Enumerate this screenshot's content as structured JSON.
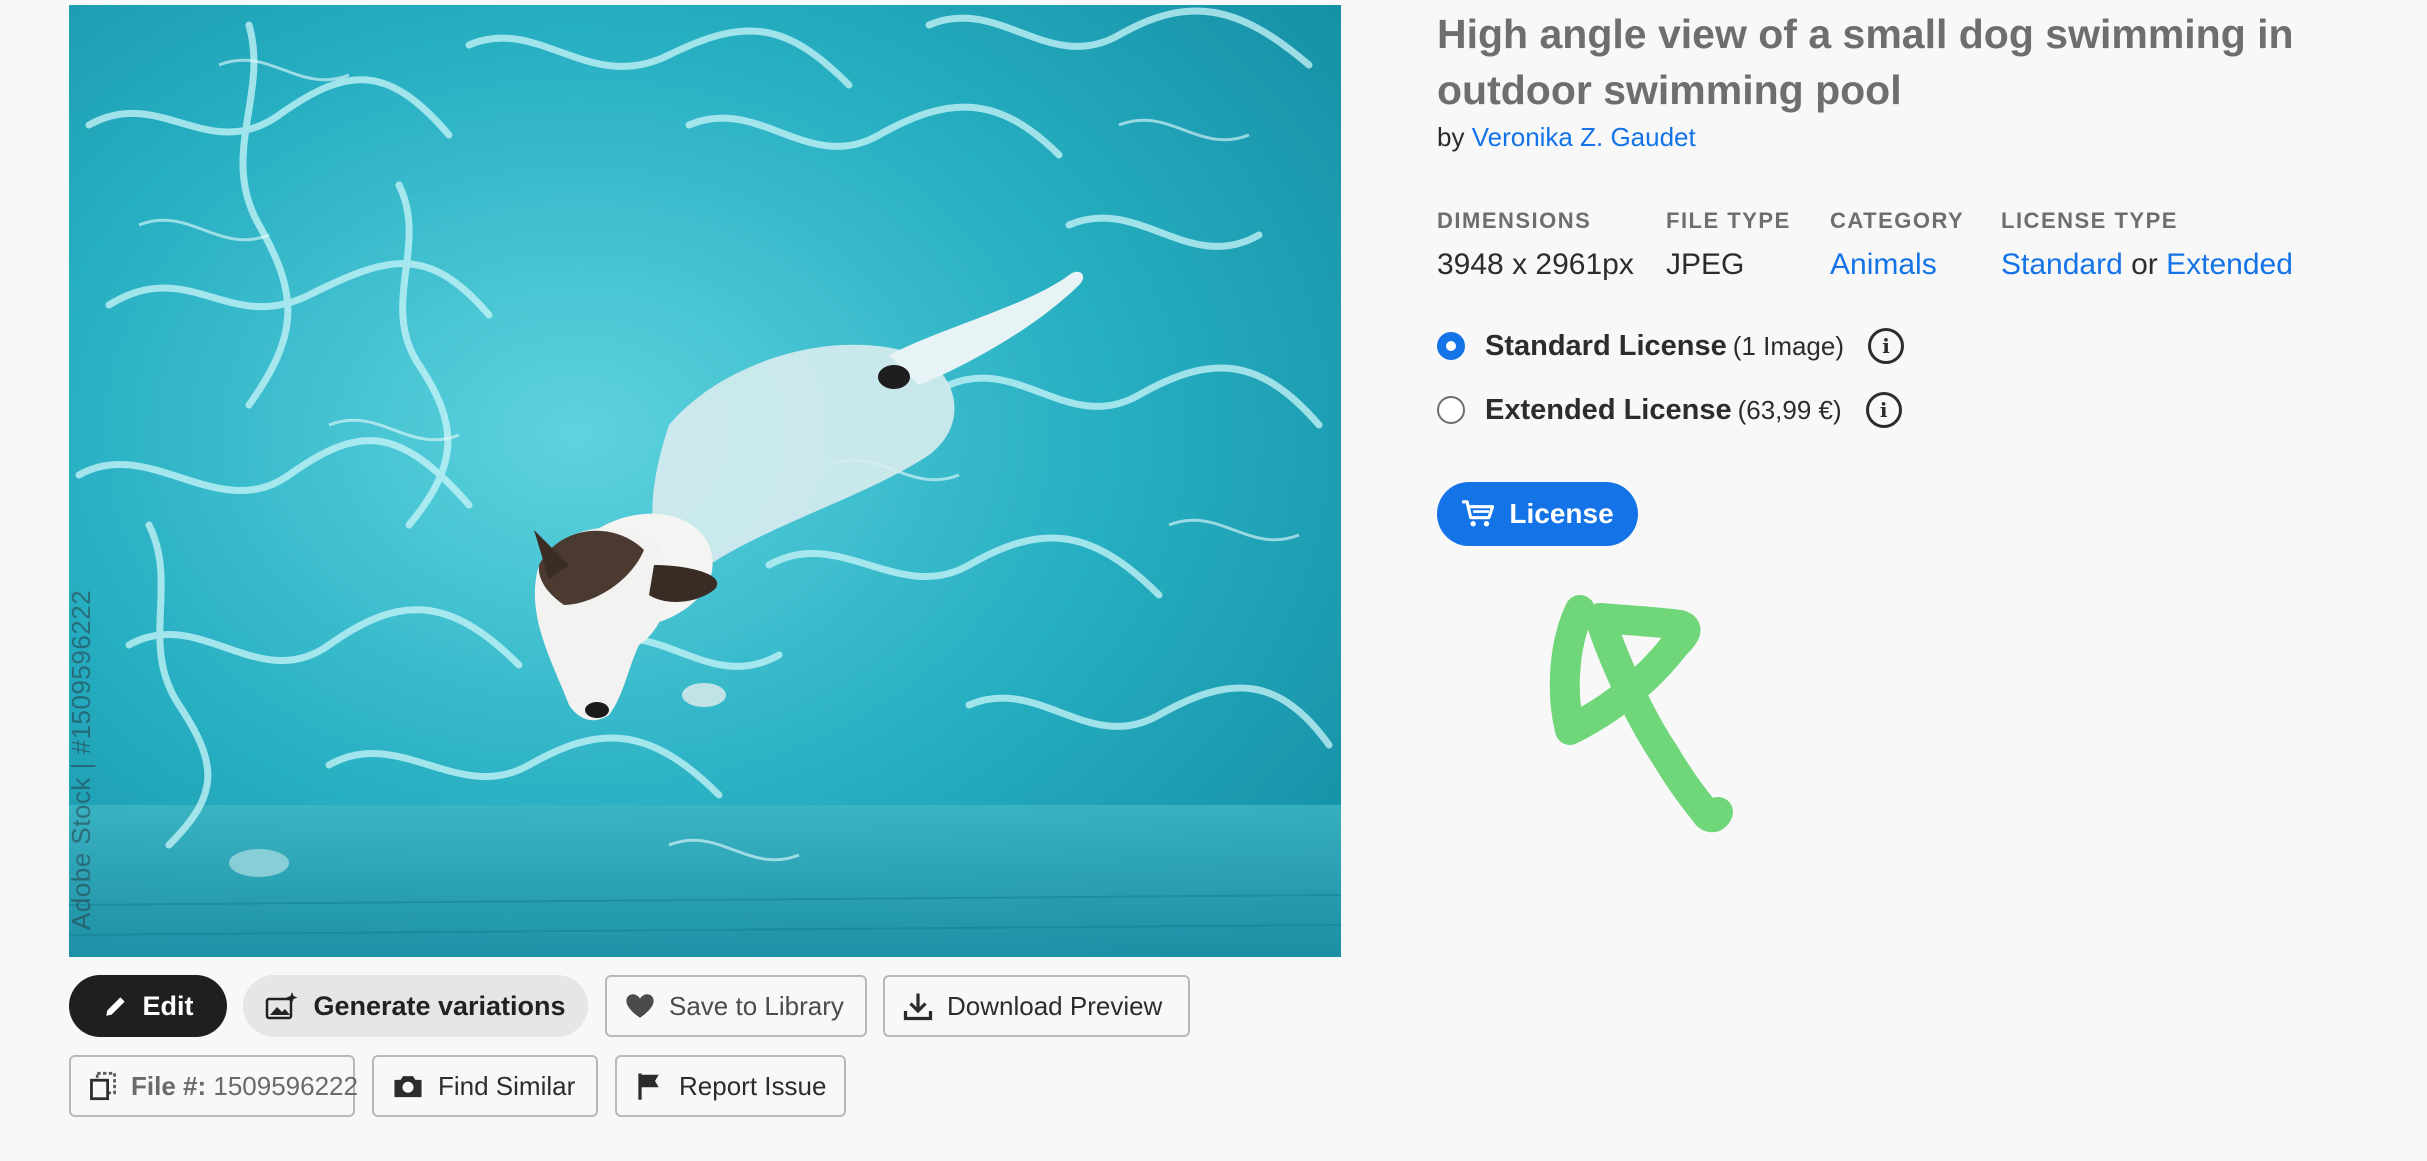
{
  "image": {
    "watermark": "Adobe Stock | #1509596222",
    "description_icon": "dog-in-pool-photo"
  },
  "actions": {
    "edit_label": "Edit",
    "generate_label": "Generate variations",
    "save_label": "Save to Library",
    "download_label": "Download Preview",
    "file_label": "File #:",
    "file_number": "1509596222",
    "find_similar_label": "Find Similar",
    "report_label": "Report Issue"
  },
  "details": {
    "title": "High angle view of a small dog swimming in outdoor swimming pool",
    "by_prefix": "by",
    "author": "Veronika Z. Gaudet",
    "dimensions_head": "DIMENSIONS",
    "dimensions_value": "3948 x 2961px",
    "filetype_head": "FILE TYPE",
    "filetype_value": "JPEG",
    "category_head": "CATEGORY",
    "category_value": "Animals",
    "licensetype_head": "LICENSE TYPE",
    "licensetype_standard": "Standard",
    "licensetype_or": "or",
    "licensetype_extended": "Extended"
  },
  "licenses": [
    {
      "name": "Standard License",
      "note": "(1 Image)",
      "selected": true
    },
    {
      "name": "Extended License",
      "note": "(63,99 €)",
      "selected": false
    }
  ],
  "license_button": "License",
  "colors": {
    "accent": "#1473e6",
    "scribble": "#5fd36a",
    "dark_button": "#1f1f1f"
  }
}
